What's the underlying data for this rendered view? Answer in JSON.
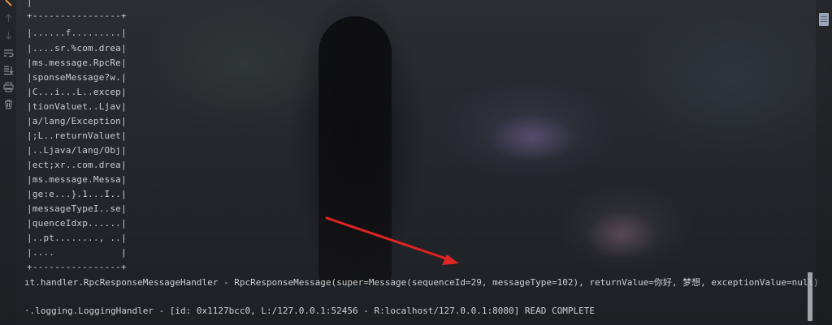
{
  "hexdump": [
    "|",
    "+----------------+",
    "|......f.........|",
    "|....sr.%com.drea|",
    "|ms.message.RpcRe|",
    "|sponseMessage?w.|",
    "|C...i...L..excep|",
    "|tionValuet..Ljav|",
    "|a/lang/Exception|",
    "|;L..returnValuet|",
    "|..Ljava/lang/Obj|",
    "|ect;xr..com.drea|",
    "|ms.message.Messa|",
    "|ge:e...}.1...I..|",
    "|messageTypeI..se|",
    "|quenceIdxp......|",
    "|..pt........, ..|",
    "|....            |",
    "+----------------+"
  ],
  "log_lines": [
    "ıt.handler.RpcResponseMessageHandler - RpcResponseMessage(super=Message(sequenceId=29, messageType=102), returnValue=你好, 梦想, exceptionValue=null)",
    "·.logging.LoggingHandler - [id: 0x1127bcc0, L:/127.0.0.1:52456 - R:localhost/127.0.0.1:8080] READ COMPLETE"
  ],
  "tools": [
    "stop-icon",
    "up-arrow-icon",
    "down-arrow-icon",
    "soft-wrap-icon",
    "scroll-to-end-icon",
    "print-icon",
    "trash-icon"
  ],
  "colors": {
    "arrow": "#e02424",
    "text": "#c9ccd1"
  }
}
